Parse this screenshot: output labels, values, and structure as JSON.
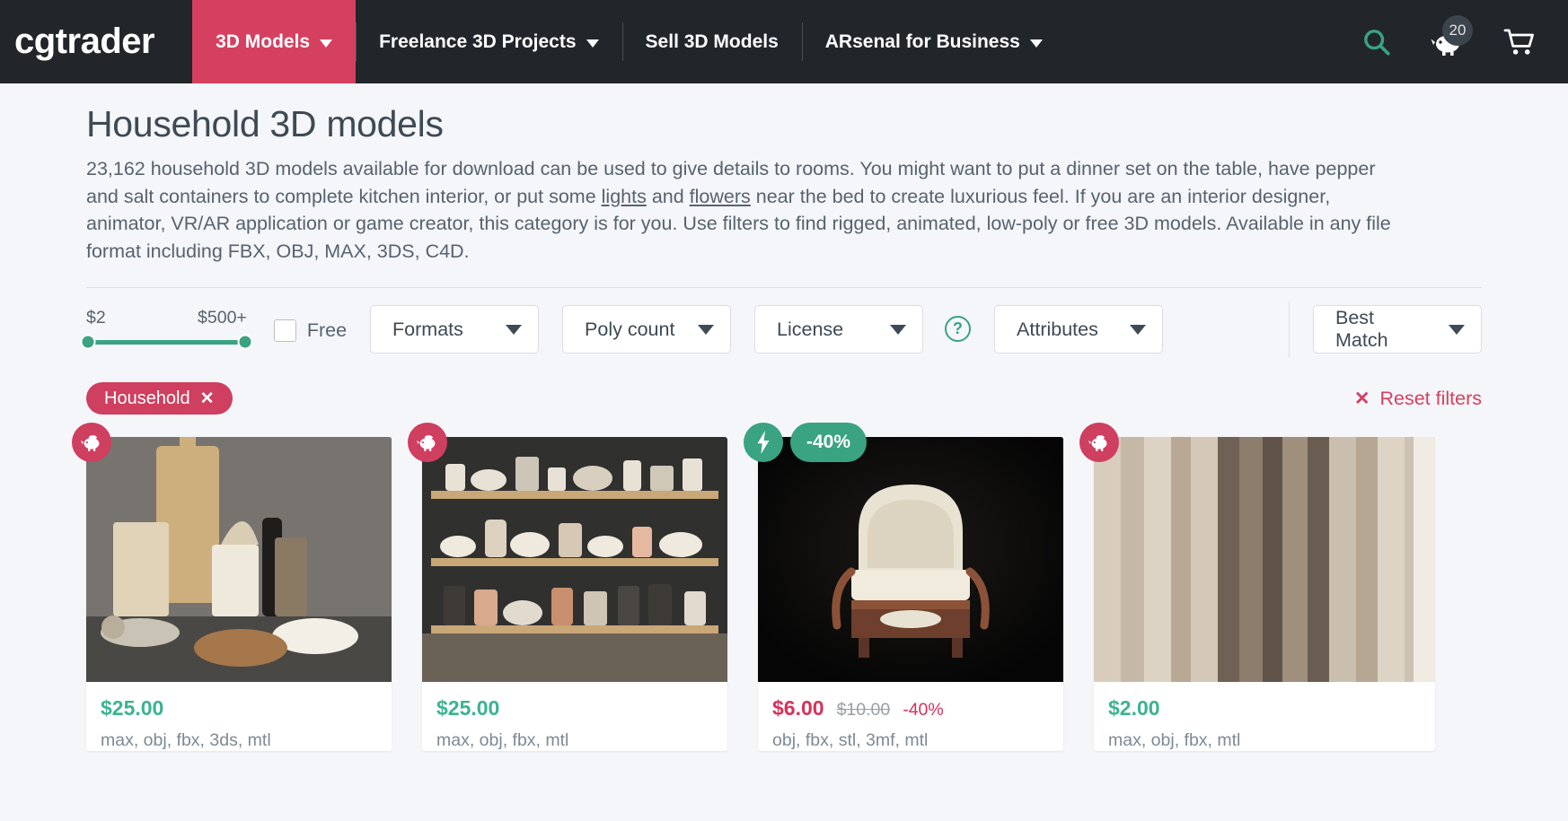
{
  "navbar": {
    "brand": "cgtrader",
    "items": [
      {
        "label": "3D Models",
        "has_caret": true,
        "active": true
      },
      {
        "label": "Freelance 3D Projects",
        "has_caret": true,
        "active": false
      },
      {
        "label": "Sell 3D Models",
        "has_caret": false,
        "active": false
      },
      {
        "label": "ARsenal for Business",
        "has_caret": true,
        "active": false
      }
    ],
    "search_icon": "search-icon",
    "piggy_icon": "piggy-bank-icon",
    "piggy_badge_count": "20",
    "cart_icon": "shopping-cart-icon"
  },
  "page": {
    "title": "Household 3D models",
    "description_part1": "23,162 household 3D models available for download can be used to give details to rooms. You might want to put a dinner set on the table, have pepper and salt containers to complete kitchen interior, or put some ",
    "link_lights": "lights",
    "description_part2": " and ",
    "link_flowers": "flowers",
    "description_part3": " near the bed to create luxurious feel. If you are an interior designer, animator, VR/AR application or game creator, this category is for you. Use filters to find rigged, animated, low-poly or free 3D models. Available in any file format including FBX, OBJ, MAX, 3DS, C4D."
  },
  "filters": {
    "price_min_label": "$2",
    "price_max_label": "$500+",
    "free_label": "Free",
    "free_checked": false,
    "dropdowns": [
      {
        "label": "Formats"
      },
      {
        "label": "Poly count"
      },
      {
        "label": "License"
      },
      {
        "label": "Attributes"
      }
    ],
    "help_icon_glyph": "?",
    "sort": {
      "label": "Best Match"
    }
  },
  "tags": {
    "chips": [
      {
        "label": "Household",
        "close_glyph": "✕"
      }
    ],
    "reset_label": "Reset filters",
    "reset_glyph": "✕"
  },
  "cards": [
    {
      "badges": [
        {
          "type": "circle-pink",
          "icon": "piggy-bank-icon"
        }
      ],
      "price": "$25.00",
      "price_color": "green",
      "old_price": "",
      "discount": "",
      "formats": "max, obj, fbx, 3ds, mtl",
      "thumb": "kitchen-utensils-cutting-boards"
    },
    {
      "badges": [
        {
          "type": "circle-pink",
          "icon": "piggy-bank-icon"
        }
      ],
      "price": "$25.00",
      "price_color": "green",
      "old_price": "",
      "discount": "",
      "formats": "max, obj, fbx, mtl",
      "thumb": "ceramic-dishware-shelves"
    },
    {
      "badges": [
        {
          "type": "circle-green",
          "icon": "lightning-bolt-icon"
        },
        {
          "type": "pill-green",
          "label": "-40%"
        }
      ],
      "price": "$6.00",
      "price_color": "red",
      "old_price": "$10.00",
      "discount": "-40%",
      "formats": "obj, fbx, stl, 3mf, mtl",
      "thumb": "upholstered-armchair-dark"
    },
    {
      "badges": [
        {
          "type": "circle-pink",
          "icon": "piggy-bank-icon"
        }
      ],
      "price": "$2.00",
      "price_color": "green",
      "old_price": "",
      "discount": "",
      "formats": "max, obj, fbx, mtl",
      "thumb": "beige-curtains-drapes"
    }
  ],
  "colors": {
    "nav_bg": "#22262b",
    "accent_pink": "#d64060",
    "accent_green": "#3aa381",
    "price_green": "#3cb392",
    "price_red": "#d6315a",
    "page_bg": "#f5f6fa"
  }
}
